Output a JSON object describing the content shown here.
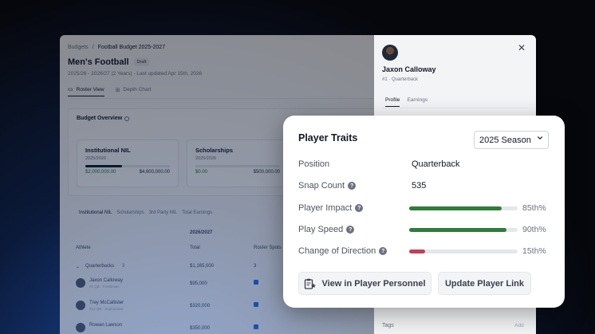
{
  "breadcrumb": {
    "root": "Budgets",
    "separator": "/",
    "current": "Football Budget 2025-2027"
  },
  "page": {
    "title": "Men's Football",
    "status_badge": "Draft",
    "subtitle": "2025/26 - 2026/27 (2 Years) · Last updated Apr 15th, 2026"
  },
  "view_tabs": [
    {
      "label": "Roster View",
      "icon": "roster-icon",
      "active": true
    },
    {
      "label": "Depth Chart",
      "icon": "grid-icon",
      "active": false
    }
  ],
  "budget_overview": {
    "title": "Budget Overview",
    "cards": [
      {
        "name": "Institutional NIL",
        "year": "2025/2026",
        "used": "$2,000,000.00",
        "total": "$4,600,000.00",
        "fill": 0.43
      },
      {
        "name": "Scholarships",
        "year": "2025/2026",
        "used": "$0.00",
        "total": "$500,000.00",
        "fill": 0.0
      }
    ]
  },
  "sub_tabs": [
    "Institutional NIL",
    "Scholarships",
    "3rd Party NIL",
    "Total Earnings"
  ],
  "table": {
    "year": "2026/2027",
    "headers": {
      "athlete": "Athlete",
      "total": "Total",
      "roster": "Roster Spots"
    },
    "group": {
      "label": "Quarterbacks",
      "count": "3",
      "total": "$1,165,000",
      "spots": "3"
    },
    "rows": [
      {
        "name": "Jaxon Calloway",
        "pos": "#1 QB · Freshman",
        "total": "$95,000"
      },
      {
        "name": "Trey McCallister",
        "pos": "#12 QB · Sophomore",
        "total": "$320,000"
      },
      {
        "name": "Rowan Lawson",
        "pos": "",
        "total": "$350,000"
      }
    ]
  },
  "drawer": {
    "player_name": "Jaxon Calloway",
    "player_sub": "#1 · Quarterback",
    "tabs": [
      "Profile",
      "Earnings"
    ],
    "tags_label": "Tags",
    "add_label": "Add"
  },
  "traits": {
    "title": "Player Traits",
    "season": "2025 Season",
    "position_label": "Position",
    "position_value": "Quarterback",
    "snap_label": "Snap Count",
    "snap_value": "535",
    "bars": [
      {
        "label": "Player Impact",
        "percentile": 0.85,
        "pct_text": "85th%",
        "color": "#2f7d3a"
      },
      {
        "label": "Play Speed",
        "percentile": 0.9,
        "pct_text": "90th%",
        "color": "#2f7d3a"
      },
      {
        "label": "Change of Direction",
        "percentile": 0.15,
        "pct_text": "15th%",
        "color": "#c2405a"
      }
    ],
    "personnel_button": "View in Player Personnel",
    "update_button": "Update Player Link"
  }
}
